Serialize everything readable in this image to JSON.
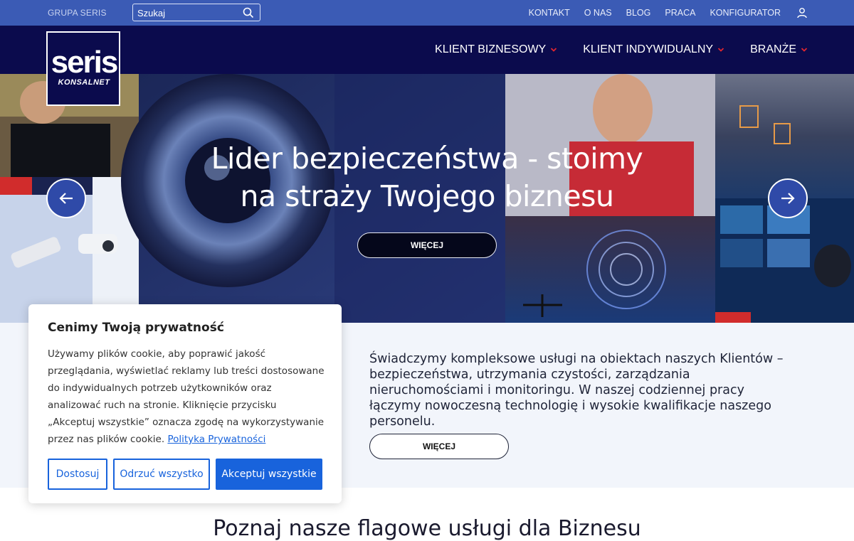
{
  "topbar": {
    "brand": "GRUPA SERIS",
    "search_placeholder": "Szukaj",
    "links": [
      "KONTAKT",
      "O NAS",
      "BLOG",
      "PRACA",
      "KONFIGURATOR"
    ]
  },
  "logo": {
    "main": "seris",
    "sub": "KONSALNET"
  },
  "nav": {
    "items": [
      "KLIENT BIZNESOWY",
      "KLIENT INDYWIDUALNY",
      "BRANŻE"
    ]
  },
  "hero": {
    "title_line1": "Lider bezpieczeństwa - stoimy",
    "title_line2": "na straży Twojego biznesu",
    "button": "WIĘCEJ"
  },
  "intro": {
    "text": "Świadczymy kompleksowe usługi na obiektach naszych Klientów – bezpieczeństwa, utrzymania czystości, zarządzania nieruchomościami i monitoringu. W naszej codziennej pracy łączymy nowoczesną technologię i wysokie kwalifikacje naszego personelu.",
    "button": "WIĘCEJ"
  },
  "section_title": "Poznaj nasze flagowe usługi dla Biznesu",
  "cookie": {
    "title": "Cenimy Twoją prywatność",
    "body": "Używamy plików cookie, aby poprawić jakość przeglądania, wyświetlać reklamy lub treści dostosowane do indywidualnych potrzeb użytkowników oraz analizować ruch na stronie. Kliknięcie przycisku „Akceptuj wszystkie” oznacza zgodę na wykorzystywanie przez nas plików cookie.",
    "link": "Polityka Prywatności",
    "btn_customize": "Dostosuj",
    "btn_reject": "Odrzuć wszystko",
    "btn_accept": "Akceptuj wszystkie"
  },
  "colors": {
    "topbar": "#3b5bb5",
    "navbar": "#0b0b4d",
    "accent_red": "#e0262f",
    "cookie_blue": "#1863dc"
  }
}
